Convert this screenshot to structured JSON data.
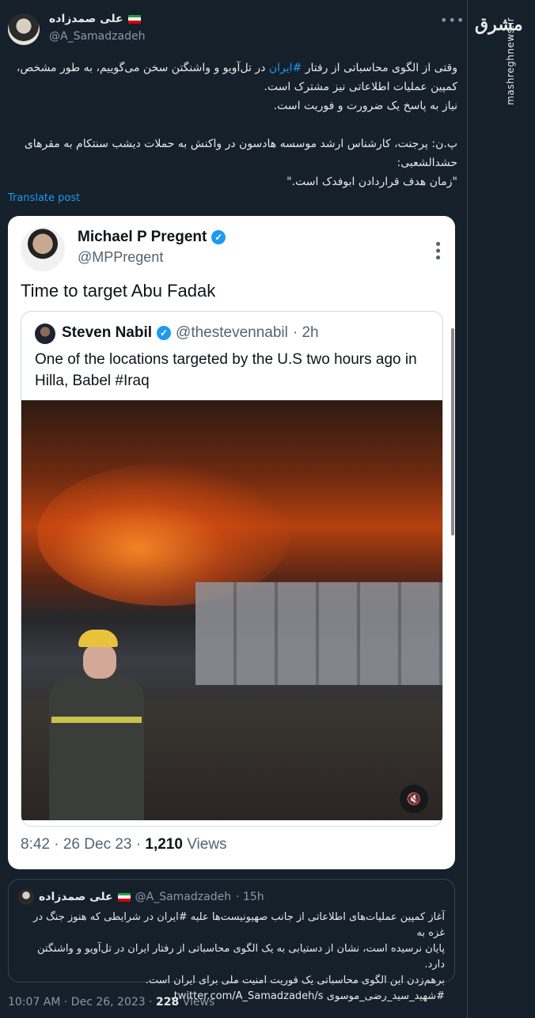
{
  "tweet": {
    "author_name": "علی صمدزاده",
    "author_handle": "@A_Samadzadeh",
    "more_label": "•••",
    "body_lines": [
      {
        "before": "وقتی از الگوی محاسباتی از رفتار ",
        "hashtag": "#ایران",
        "after": " در تل‌آویو و واشنگتن سخن می‌گوییم، به طور مشخص،"
      },
      {
        "before": "کمپین عملیات اطلاعاتی نیز مشترک است.",
        "hashtag": "",
        "after": ""
      },
      {
        "before": "نیاز به پاسخ یک ضرورت و فوریت است.",
        "hashtag": "",
        "after": ""
      },
      {
        "before": "",
        "hashtag": "",
        "after": ""
      },
      {
        "before": "پ.ن: پرجنت، کارشناس ارشد موسسه هادسون در واکنش به حملات دیشب سنتکام به مقرهای",
        "hashtag": "",
        "after": ""
      },
      {
        "before": "حشدالشعبی:",
        "hashtag": "",
        "after": ""
      },
      {
        "before": "\"زمان هدف قراردادن ابوفدک است.\"",
        "hashtag": "",
        "after": ""
      }
    ],
    "translate_label": "Translate post",
    "meta_time": "10:07 AM · Dec 26, 2023 · ",
    "meta_views_count": "228",
    "meta_views_label": " Views"
  },
  "embedded": {
    "author_name": "Michael P Pregent",
    "author_handle": "@MPPregent",
    "more_label": "•••",
    "text": "Time to target Abu Fadak",
    "quote": {
      "author_name": "Steven Nabil",
      "author_handle": "@thestevennabil",
      "time": "· 2h",
      "text": "One of the locations targeted by the U.S two hours ago in Hilla, Babel #Iraq"
    },
    "footer_time": "8:42 · 26 Dec 23 · ",
    "footer_views_count": "1,210",
    "footer_views_label": " Views"
  },
  "quoted_tweet": {
    "author_name": "علی صمدزاده",
    "author_handle": "@A_Samadzadeh",
    "time": "· 15h",
    "lines": [
      "آغاز کمپین عملیات‌های اطلاعاتی از جانب صهیونیست‌ها علیه #ایران در شرایطی که هنوز جنگ در غزه به",
      "پایان نرسیده است، نشان از دستیابی به یک الگوی محاسباتی از رفتار ایران در تل‌آویو و واشنگتن دارد.",
      "برهم‌زدن این الگوی محاسباتی یک فوریت امنیت ملی برای ایران است.",
      "#شهید_سید_رضی_موسوی twitter.com/A_Samadzadeh/s..."
    ]
  },
  "watermark": {
    "mark": "مشرق",
    "site": "mashreghnews.ir"
  },
  "icons": {
    "verified": "verified-badge-icon",
    "mute": "speaker-muted-icon"
  },
  "colors": {
    "background": "#15202b",
    "accent": "#1d9bf0",
    "card": "#ffffff"
  }
}
